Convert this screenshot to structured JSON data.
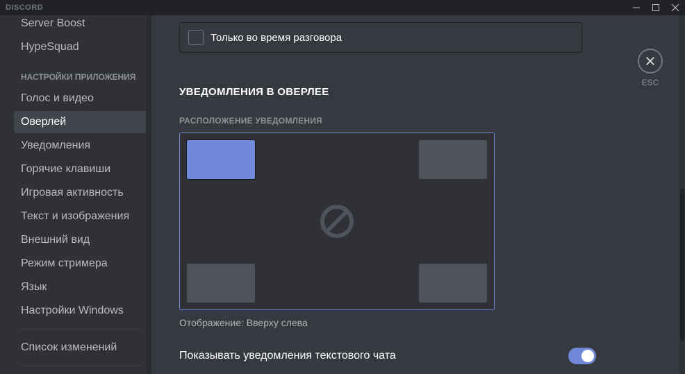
{
  "titlebar": {
    "brand": "DISCORD"
  },
  "sidebar": {
    "items_top": [
      {
        "label": "Server Boost"
      },
      {
        "label": "HypeSquad"
      }
    ],
    "section_header": "Настройки приложения",
    "items": [
      {
        "label": "Голос и видео",
        "active": false
      },
      {
        "label": "Оверлей",
        "active": true
      },
      {
        "label": "Уведомления",
        "active": false
      },
      {
        "label": "Горячие клавиши",
        "active": false
      },
      {
        "label": "Игровая активность",
        "active": false
      },
      {
        "label": "Текст и изображения",
        "active": false
      },
      {
        "label": "Внешний вид",
        "active": false
      },
      {
        "label": "Режим стримера",
        "active": false
      },
      {
        "label": "Язык",
        "active": false
      },
      {
        "label": "Настройки Windows",
        "active": false
      }
    ],
    "changelog": "Список изменений"
  },
  "content": {
    "checkbox": {
      "label": "Только во время разговора",
      "checked": false
    },
    "section_title": "Уведомления в оверлее",
    "position": {
      "header": "Расположение уведомления",
      "caption": "Отображение: Вверху слева",
      "selected": "top-left"
    },
    "text_notifications": {
      "label": "Показывать уведомления текстового чата",
      "enabled": true
    }
  },
  "esc": {
    "label": "ESC"
  }
}
